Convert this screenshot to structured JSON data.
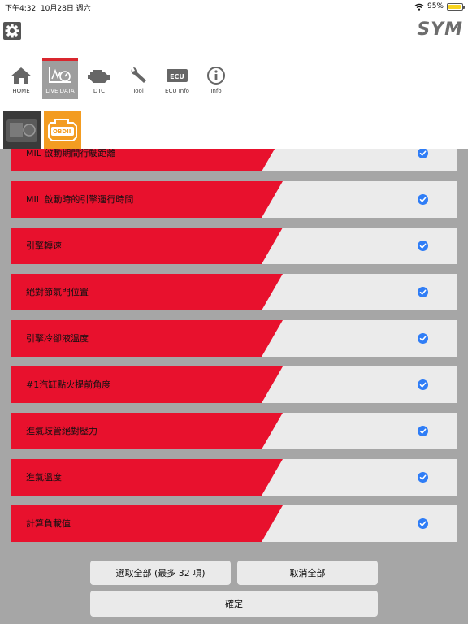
{
  "status": {
    "time": "下午4:32",
    "date": "10月28日 週六",
    "battery": "95%",
    "battery_level": 0.95
  },
  "header": {
    "logo_text": "SYM",
    "settings_icon": "gear-icon"
  },
  "nav": [
    {
      "label": "HOME",
      "icon": "home-icon"
    },
    {
      "label": "LIVE DATA",
      "icon": "gauge-icon"
    },
    {
      "label": "DTC",
      "icon": "engine-icon"
    },
    {
      "label": "Tool",
      "icon": "wrench-icon"
    },
    {
      "label": "ECU Info",
      "icon": "ecu-icon"
    },
    {
      "label": "Info",
      "icon": "info-icon"
    }
  ],
  "subtabs": [
    {
      "label": "",
      "icon": "engine-photo-icon"
    },
    {
      "label": "OBDII",
      "icon": "obd-icon"
    }
  ],
  "items": [
    {
      "label": "MIL 啟動期間行駛距離",
      "checked": true
    },
    {
      "label": "MIL 啟動時的引擎運行時間",
      "checked": true
    },
    {
      "label": "引擎轉速",
      "checked": true
    },
    {
      "label": "絕對節氣門位置",
      "checked": true
    },
    {
      "label": "引擎冷卻液溫度",
      "checked": true
    },
    {
      "label": "#1汽缸點火提前角度",
      "checked": true
    },
    {
      "label": "進氣歧管絕對壓力",
      "checked": true
    },
    {
      "label": "進氣溫度",
      "checked": true
    },
    {
      "label": "計算負載值",
      "checked": true
    }
  ],
  "buttons": {
    "select_all": "選取全部 (最多 32 項)",
    "deselect_all": "取消全部",
    "confirm": "確定"
  },
  "colors": {
    "accent_red": "#e8112d",
    "check_blue": "#2f7df6",
    "obd_orange": "#f39c21"
  }
}
